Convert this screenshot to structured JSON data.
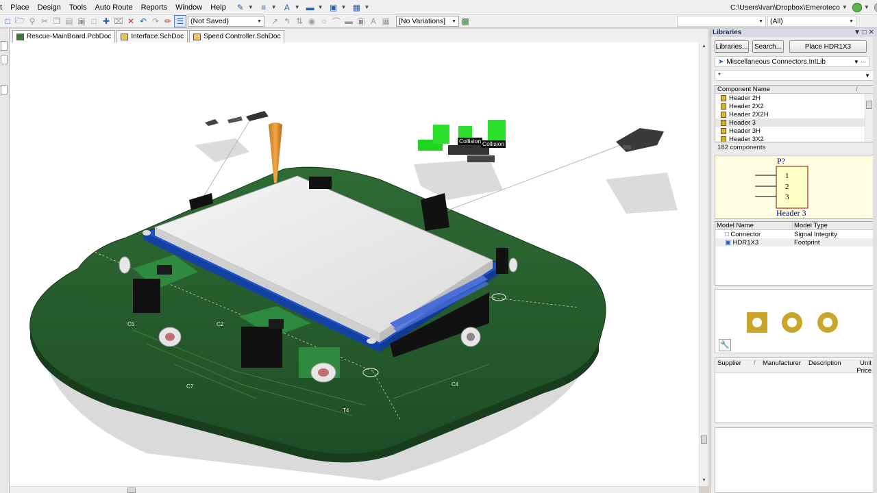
{
  "menubar": {
    "items": [
      "t",
      "Place",
      "Design",
      "Tools",
      "Auto Route",
      "Reports",
      "Window",
      "Help"
    ],
    "path": "C:\\Users\\Ivan\\Dropbox\\Emeroteco"
  },
  "toolbar": {
    "saved_state": "(Not Saved)",
    "variations": "[No Variations]",
    "filter_value": "(All)"
  },
  "doc_tabs": [
    {
      "label": "Rescue-MainBoard.PcbDoc",
      "type": "pcb"
    },
    {
      "label": "Interface.SchDoc",
      "type": "sch"
    },
    {
      "label": "Speed Controller.SchDoc",
      "type": "sch"
    }
  ],
  "viewport": {
    "collision_labels": [
      "Collision",
      "Collision"
    ],
    "silk_labels": [
      "C5",
      "C7",
      "C2",
      "C4",
      "T4"
    ]
  },
  "libraries_panel": {
    "title": "Libraries",
    "buttons": {
      "libraries": "Libraries...",
      "search": "Search...",
      "place": "Place HDR1X3"
    },
    "library": "Miscellaneous Connectors.IntLib",
    "filter": "*",
    "component_header": "Component Name",
    "components": [
      "Header 2H",
      "Header 2X2",
      "Header 2X2H",
      "Header 3",
      "Header 3H",
      "Header 3X2"
    ],
    "selected_component": "Header 3",
    "count": "182 components",
    "symbol": {
      "designator": "P?",
      "pins": [
        "1",
        "2",
        "3"
      ],
      "name": "Header 3"
    },
    "model_headers": [
      "Model Name",
      "Model Type"
    ],
    "models": [
      {
        "name": "Connector",
        "type": "Signal Integrity"
      },
      {
        "name": "HDR1X3",
        "type": "Footprint"
      }
    ],
    "supplier_headers": [
      "Supplier",
      "Manufacturer",
      "Description",
      "Unit Price"
    ]
  }
}
